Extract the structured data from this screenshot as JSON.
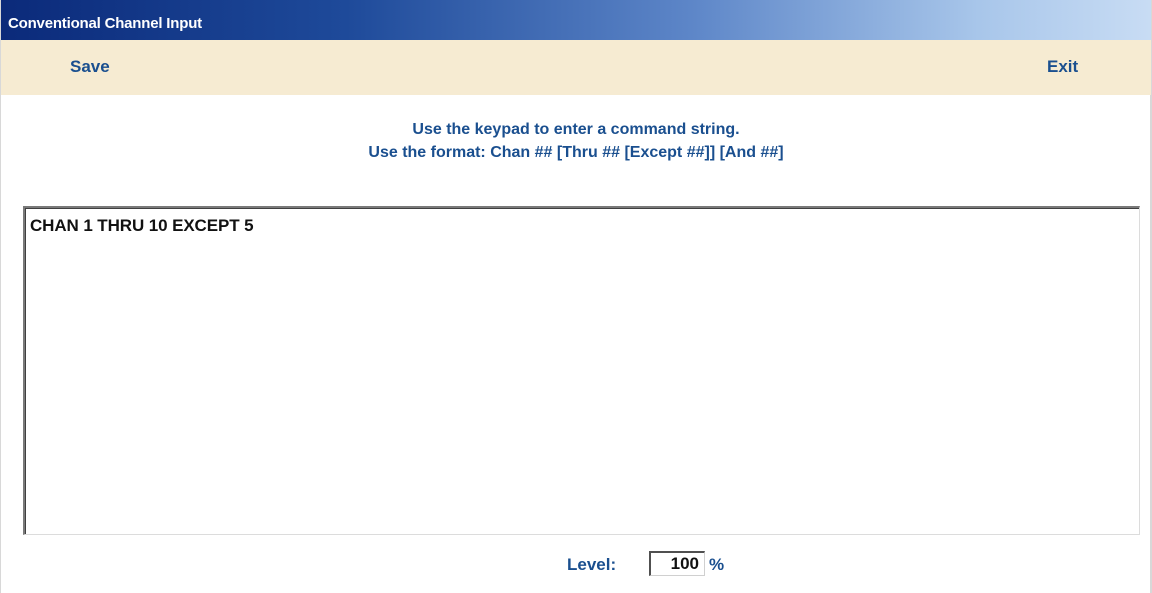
{
  "window": {
    "title": "Conventional Channel Input"
  },
  "menu": {
    "save_label": "Save",
    "exit_label": "Exit"
  },
  "instructions": {
    "line1": "Use the keypad to enter a command string.",
    "line2": "Use the format: Chan ## [Thru ## [Except ##]] [And ##]"
  },
  "command": {
    "value": "CHAN 1 THRU 10 EXCEPT 5"
  },
  "level": {
    "label": "Level:",
    "value": "100",
    "unit": "%"
  },
  "colors": {
    "title_gradient_start": "#0b2a7a",
    "title_gradient_end": "#c8dcf4",
    "menubar_bg": "#f6ebd2",
    "accent_text": "#1a4f8f"
  }
}
